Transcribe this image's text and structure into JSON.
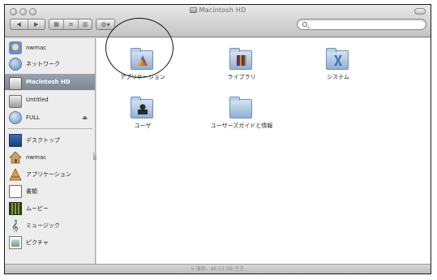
{
  "window": {
    "title": "Macintosh HD",
    "status": "5 項目、46.53 GB 空き"
  },
  "toolbar": {
    "back_label": "◀",
    "forward_label": "▶",
    "view_icon_label": "▦",
    "view_list_label": "≡",
    "view_column_label": "▥",
    "action_label": "⚙▾"
  },
  "sidebar": {
    "items": [
      {
        "label": "nwmac",
        "icon": "network-computer-icon"
      },
      {
        "label": "ネットワーク",
        "icon": "network-globe-icon"
      },
      {
        "label": "Macintosh HD",
        "icon": "hard-drive-icon",
        "selected": true
      },
      {
        "label": "Untitled",
        "icon": "drive-icon"
      },
      {
        "label": "FULL",
        "icon": "disc-icon",
        "eject": "⏏"
      },
      {
        "label": "デスクトップ",
        "icon": "desktop-icon"
      },
      {
        "label": "nwmac",
        "icon": "home-icon"
      },
      {
        "label": "アプリケーション",
        "icon": "applications-icon"
      },
      {
        "label": "書類",
        "icon": "documents-icon"
      },
      {
        "label": "ムービー",
        "icon": "movies-icon"
      },
      {
        "label": "ミュージック",
        "icon": "music-icon"
      },
      {
        "label": "ピクチャ",
        "icon": "pictures-icon"
      }
    ]
  },
  "content": {
    "folders": [
      {
        "label": "アプリケーション",
        "icon": "applications-folder-icon"
      },
      {
        "label": "ライブラリ",
        "icon": "library-folder-icon"
      },
      {
        "label": "システム",
        "icon": "system-folder-icon"
      },
      {
        "label": "ユーザ",
        "icon": "users-folder-icon"
      },
      {
        "label": "ユーザーズガイドと情報",
        "icon": "folder-icon"
      }
    ]
  },
  "colors": {
    "sidebar_bg": "#ededed",
    "selection": "#7d8791",
    "folder_blue": "#8fb0d6",
    "annotation_circle": "#111111"
  }
}
